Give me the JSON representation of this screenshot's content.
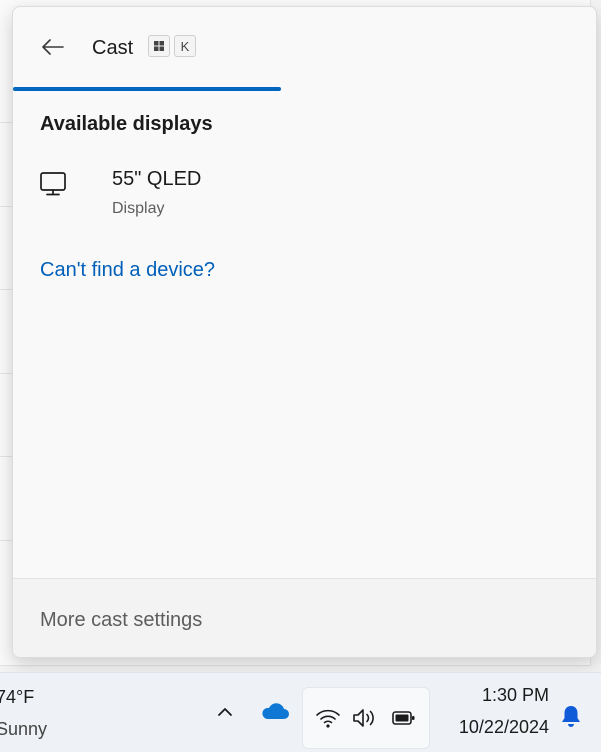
{
  "flyout": {
    "title": "Cast",
    "shortcut_keys": [
      "⊞",
      "K"
    ],
    "section_title": "Available displays",
    "progress_fraction": 0.46,
    "devices": [
      {
        "name": "55\" QLED",
        "type": "Display",
        "icon": "monitor-icon"
      }
    ],
    "help_link": "Can't find a device?",
    "footer_link": "More cast settings"
  },
  "taskbar": {
    "weather": {
      "temperature": "74°F",
      "condition": "Sunny"
    },
    "tray_icons": [
      "chevron-up-icon",
      "onedrive-icon",
      "wifi-icon",
      "volume-icon",
      "battery-icon",
      "notification-bell-icon"
    ],
    "time": "1:30 PM",
    "date": "10/22/2024"
  },
  "colors": {
    "accent": "#0067c0",
    "link": "#005fb8",
    "onedrive": "#0f78d4",
    "bell": "#0f5bd8"
  }
}
